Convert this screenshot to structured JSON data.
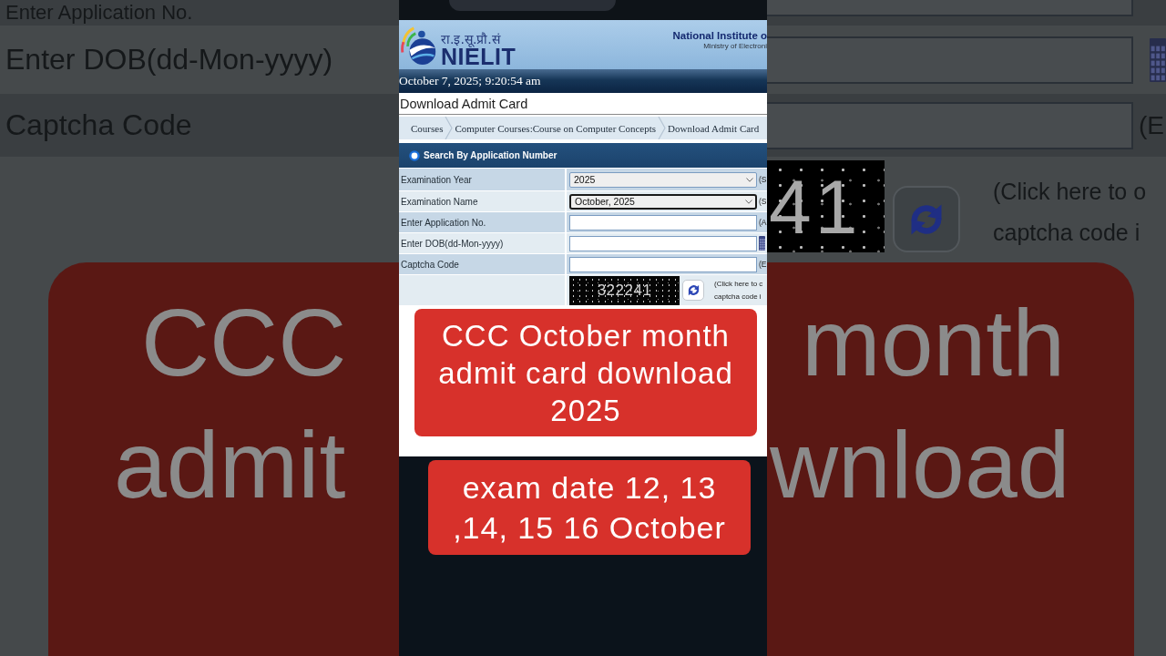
{
  "backdrop_left": {
    "fields": [
      {
        "label": "Enter Application No."
      },
      {
        "label": "Enter DOB(dd-Mon-yyyy)"
      },
      {
        "label": "Captcha Code"
      }
    ],
    "caption_words": [
      "CCC",
      "admit"
    ]
  },
  "backdrop_right": {
    "fields": [
      {
        "kind": "text"
      },
      {
        "kind": "date"
      },
      {
        "kind": "text",
        "hint": "(E"
      }
    ],
    "captcha": {
      "code": "41"
    },
    "help_text": [
      "(Click here to o",
      "captcha code i"
    ],
    "caption_words": [
      "month",
      "wnload"
    ]
  },
  "header": {
    "logo_hindi": "रा.इ.सू.प्रौ.सं",
    "logo_name": "NIELIT",
    "institute": "National Institute o",
    "ministry": "Ministry of Electroni"
  },
  "date_time": "October 7, 2025; 9:20:54 am",
  "page_title": "Download Admit Card",
  "breadcrumb": [
    "Courses",
    "Computer Courses:Course on Computer Concepts",
    "Download Admit Card"
  ],
  "search_option": {
    "label": "Search By Application Number",
    "selected": true
  },
  "form": {
    "fields": [
      {
        "kind": "select",
        "label": "Examination Year",
        "value": "2025",
        "focused": false,
        "hint": "(S"
      },
      {
        "kind": "select",
        "label": "Examination Name",
        "value": "October, 2025",
        "focused": true,
        "hint": "(S"
      },
      {
        "kind": "text",
        "label": "Enter Application No.",
        "focused": false,
        "hint": "(A"
      },
      {
        "kind": "date",
        "label": "Enter DOB(dd-Mon-yyyy)",
        "focused": false
      },
      {
        "kind": "text",
        "label": "Captcha Code",
        "focused": false,
        "hint": "(E"
      }
    ],
    "captcha": {
      "code": "322241",
      "help_text": [
        "(Click here to c",
        "captcha code i"
      ]
    }
  },
  "captions": [
    {
      "text": "CCC October month admit card download 2025"
    },
    {
      "text": "exam date 12, 13 ,14, 15 16 October"
    }
  ]
}
